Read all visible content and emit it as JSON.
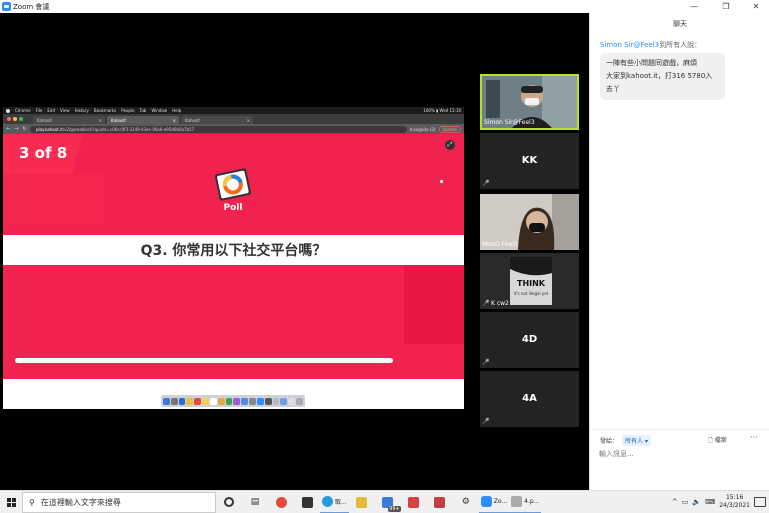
{
  "titlebar": {
    "title": "Zoom 會議",
    "minimize": "—",
    "restore": "❐",
    "close": "✕"
  },
  "browser": {
    "menubar": [
      "Chrome",
      "File",
      "Edit",
      "View",
      "History",
      "Bookmarks",
      "People",
      "Tab",
      "Window",
      "Help"
    ],
    "menubar_status": "100% ▮ Wed 15:16",
    "tabs": [
      "Kahoot!",
      "Kahoot!",
      "Kahoot!"
    ],
    "url_domain": "play.kahoot.it",
    "url_path": "/v2/gameblock?quizId=c06cc0f3-3149-43ec-96a6-a95d0b0a7b57",
    "incognito": "Incognito (2)",
    "update": "Update"
  },
  "kahoot": {
    "counter": "3 of 8",
    "poll_label": "Poll",
    "question": "Q3. 你常用以下社交平台嗎？",
    "progress_fraction": 0.82
  },
  "gallery": {
    "tiles": [
      {
        "name": "Simon Sir@Feel3",
        "type": "video"
      },
      {
        "name": "KK",
        "type": "avatar"
      },
      {
        "name": "MissO Feel3",
        "type": "video"
      },
      {
        "name": "K cw2",
        "type": "video"
      },
      {
        "name": "4D",
        "type": "avatar"
      },
      {
        "name": "4A",
        "type": "avatar"
      }
    ],
    "think_text": "THINK",
    "think_sub": "it's not illegal yet"
  },
  "chat": {
    "title": "聊天",
    "sender": "Simon Sir@Feel3",
    "to": "到所有人說：",
    "message_lines": [
      "一陣有些小問題同遊戲，麻煩",
      "大家到kahoot.it，打316 5780入",
      "去丫"
    ],
    "send_to_label": "發給：",
    "recipient": "所有人",
    "file_label": "檔案",
    "more": "···",
    "input_placeholder": "輸入訊息..."
  },
  "taskbar": {
    "search_placeholder": "在這裡輸入文字來搜尋",
    "app_zoom": "Zo...",
    "app_edge": "取...",
    "app_4p": "4.p...",
    "badge_99": "99+",
    "time": "15:16",
    "date": "24/3/2021"
  },
  "colors": {
    "kahoot_red": "#f0224f",
    "zoom_blue": "#2D8CFF",
    "active_speaker": "#b8e02b"
  }
}
